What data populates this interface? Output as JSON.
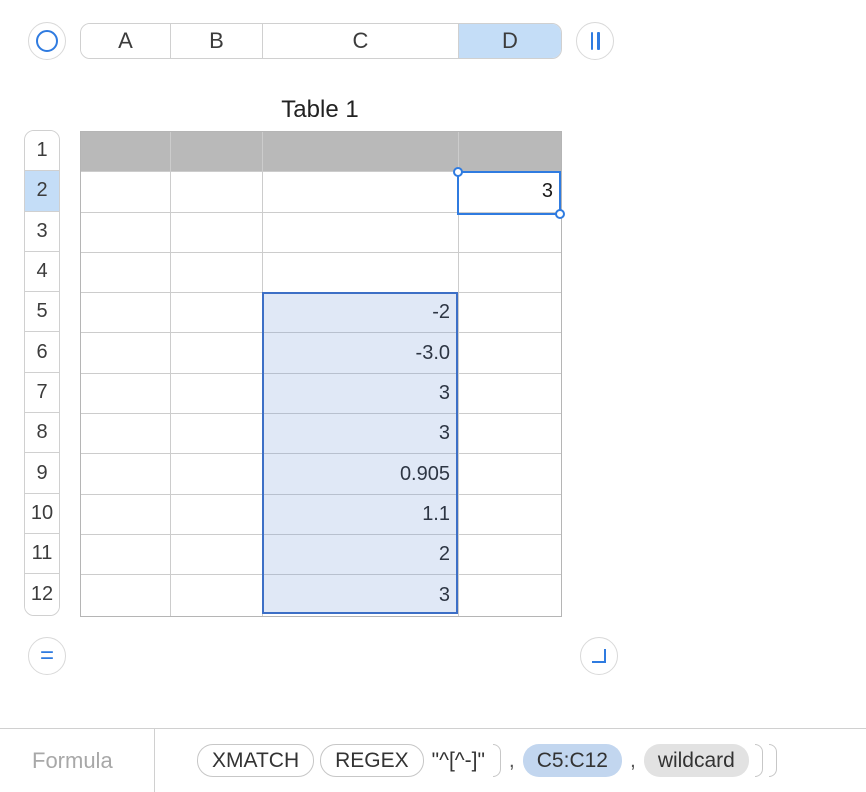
{
  "table": {
    "title": "Table 1",
    "columns": [
      "A",
      "B",
      "C",
      "D"
    ],
    "selected_column": "D",
    "rows": [
      "1",
      "2",
      "3",
      "4",
      "5",
      "6",
      "7",
      "8",
      "9",
      "10",
      "11",
      "12"
    ],
    "selected_row": "2",
    "col_widths": {
      "A": 90,
      "B": 92,
      "C": 196,
      "D": 102
    }
  },
  "cells": {
    "D2": "3",
    "C5": "-2",
    "C6": "-3.0",
    "C7": "3",
    "C8": "3",
    "C9": "0.905",
    "C10": "1.1",
    "C11": "2",
    "C12": "3"
  },
  "selection": {
    "active_cell": "D2",
    "highlighted_range": "C5:C12"
  },
  "formula_bar": {
    "label": "Formula",
    "tokens": {
      "fn1": "XMATCH",
      "fn2": "REGEX",
      "str": "\"^[^-]\"",
      "ref": "C5:C12",
      "arg": "wildcard"
    }
  },
  "icons": {
    "top_left": "select-circle",
    "top_right": "pause",
    "bottom_left": "equals",
    "bottom_right": "corner-resize"
  }
}
